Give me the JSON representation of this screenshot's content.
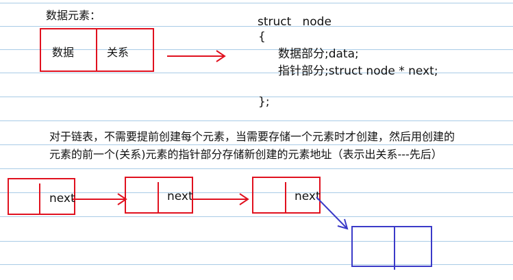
{
  "section_title": "数据元素：",
  "element_box": {
    "left_label": "数据",
    "right_label": "关系"
  },
  "code": {
    "line1": "struct   node",
    "line2": "{",
    "line3": "数据部分;data;",
    "line4": "指针部分;struct node * next;",
    "line5": "};"
  },
  "description": {
    "line1": "对于链表，不需要提前创建每个元素，当需要存储一个元素时才创建，然后用创建的",
    "line2": "元素的前一个(关系)元素的指针部分存储新创建的元素地址（表示出关系---先后）"
  },
  "nodes": [
    {
      "next_label": "next"
    },
    {
      "next_label": "next"
    },
    {
      "next_label": "next"
    }
  ],
  "colors": {
    "rule_line": "#a8cbe6",
    "red_stroke": "#e0101e",
    "blue_stroke": "#3a3ac8"
  }
}
